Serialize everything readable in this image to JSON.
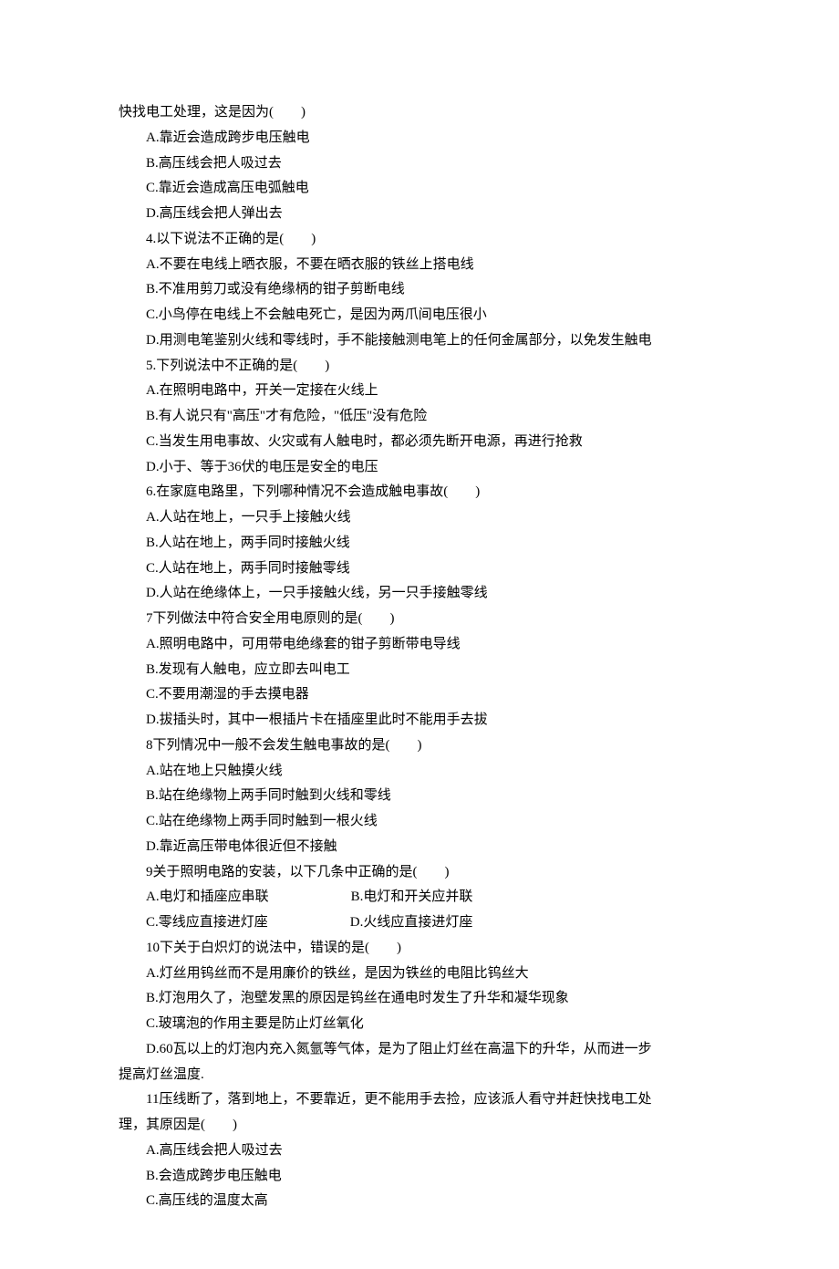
{
  "lines": [
    {
      "indent": false,
      "text": "快找电工处理，这是因为(　　)"
    },
    {
      "indent": true,
      "text": "A.靠近会造成跨步电压触电"
    },
    {
      "indent": true,
      "text": "B.高压线会把人吸过去"
    },
    {
      "indent": true,
      "text": "C.靠近会造成高压电弧触电"
    },
    {
      "indent": true,
      "text": "D.高压线会把人弹出去"
    },
    {
      "indent": true,
      "text": "4.以下说法不正确的是(　　)"
    },
    {
      "indent": true,
      "text": "A.不要在电线上晒衣服，不要在晒衣服的铁丝上搭电线"
    },
    {
      "indent": true,
      "text": "B.不准用剪刀或没有绝缘柄的钳子剪断电线"
    },
    {
      "indent": true,
      "text": "C.小鸟停在电线上不会触电死亡，是因为两爪间电压很小"
    },
    {
      "indent": true,
      "text": "D.用测电笔鉴别火线和零线时，手不能接触测电笔上的任何金属部分，以免发生触电"
    },
    {
      "indent": true,
      "text": "5.下列说法中不正确的是(　　)"
    },
    {
      "indent": true,
      "text": "A.在照明电路中，开关一定接在火线上"
    },
    {
      "indent": true,
      "text": "B.有人说只有\"高压\"才有危险，\"低压\"没有危险"
    },
    {
      "indent": true,
      "text": "C.当发生用电事故、火灾或有人触电时，都必须先断开电源，再进行抢救"
    },
    {
      "indent": true,
      "text": "D.小于、等于36伏的电压是安全的电压"
    },
    {
      "indent": true,
      "text": "6.在家庭电路里，下列哪种情况不会造成触电事故(　　)"
    },
    {
      "indent": true,
      "text": "A.人站在地上，一只手上接触火线"
    },
    {
      "indent": true,
      "text": "B.人站在地上，两手同时接触火线"
    },
    {
      "indent": true,
      "text": "C.人站在地上，两手同时接触零线"
    },
    {
      "indent": true,
      "text": "D.人站在绝缘体上，一只手接触火线，另一只手接触零线"
    },
    {
      "indent": true,
      "text": "7下列做法中符合安全用电原则的是(　　)"
    },
    {
      "indent": true,
      "text": "A.照明电路中，可用带电绝缘套的钳子剪断带电导线"
    },
    {
      "indent": true,
      "text": "B.发现有人触电，应立即去叫电工"
    },
    {
      "indent": true,
      "text": "C.不要用潮湿的手去摸电器"
    },
    {
      "indent": true,
      "text": "D.拔插头时，其中一根插片卡在插座里此时不能用手去拔"
    },
    {
      "indent": true,
      "text": "8下列情况中一般不会发生触电事故的是(　　)"
    },
    {
      "indent": true,
      "text": "A.站在地上只触摸火线"
    },
    {
      "indent": true,
      "text": "B.站在绝缘物上两手同时触到火线和零线"
    },
    {
      "indent": true,
      "text": "C.站在绝缘物上两手同时触到一根火线"
    },
    {
      "indent": true,
      "text": "D.靠近高压带电体很近但不接触"
    },
    {
      "indent": true,
      "text": "9关于照明电路的安装，以下几条中正确的是(　　)"
    },
    {
      "indent": true,
      "text": "A.电灯和插座应串联　　　　　　B.电灯和开关应并联"
    },
    {
      "indent": true,
      "text": "C.零线应直接进灯座　　　　　　D.火线应直接进灯座"
    },
    {
      "indent": true,
      "text": "10下关于白炽灯的说法中，错误的是(　　)"
    },
    {
      "indent": true,
      "text": "A.灯丝用钨丝而不是用廉价的铁丝，是因为铁丝的电阻比钨丝大"
    },
    {
      "indent": true,
      "text": "B.灯泡用久了，泡壁发黑的原因是钨丝在通电时发生了升华和凝华现象"
    },
    {
      "indent": true,
      "text": "C.玻璃泡的作用主要是防止灯丝氧化"
    },
    {
      "indent": true,
      "text": "D.60瓦以上的灯泡内充入氮氩等气体，是为了阻止灯丝在高温下的升华，从而进一步"
    },
    {
      "indent": false,
      "text": "提高灯丝温度."
    },
    {
      "indent": true,
      "text": "11压线断了，落到地上，不要靠近，更不能用手去捡，应该派人看守并赶快找电工处"
    },
    {
      "indent": false,
      "text": "理，其原因是(　　)"
    },
    {
      "indent": true,
      "text": "A.高压线会把人吸过去"
    },
    {
      "indent": true,
      "text": "B.会造成跨步电压触电"
    },
    {
      "indent": true,
      "text": "C.高压线的温度太高"
    }
  ]
}
